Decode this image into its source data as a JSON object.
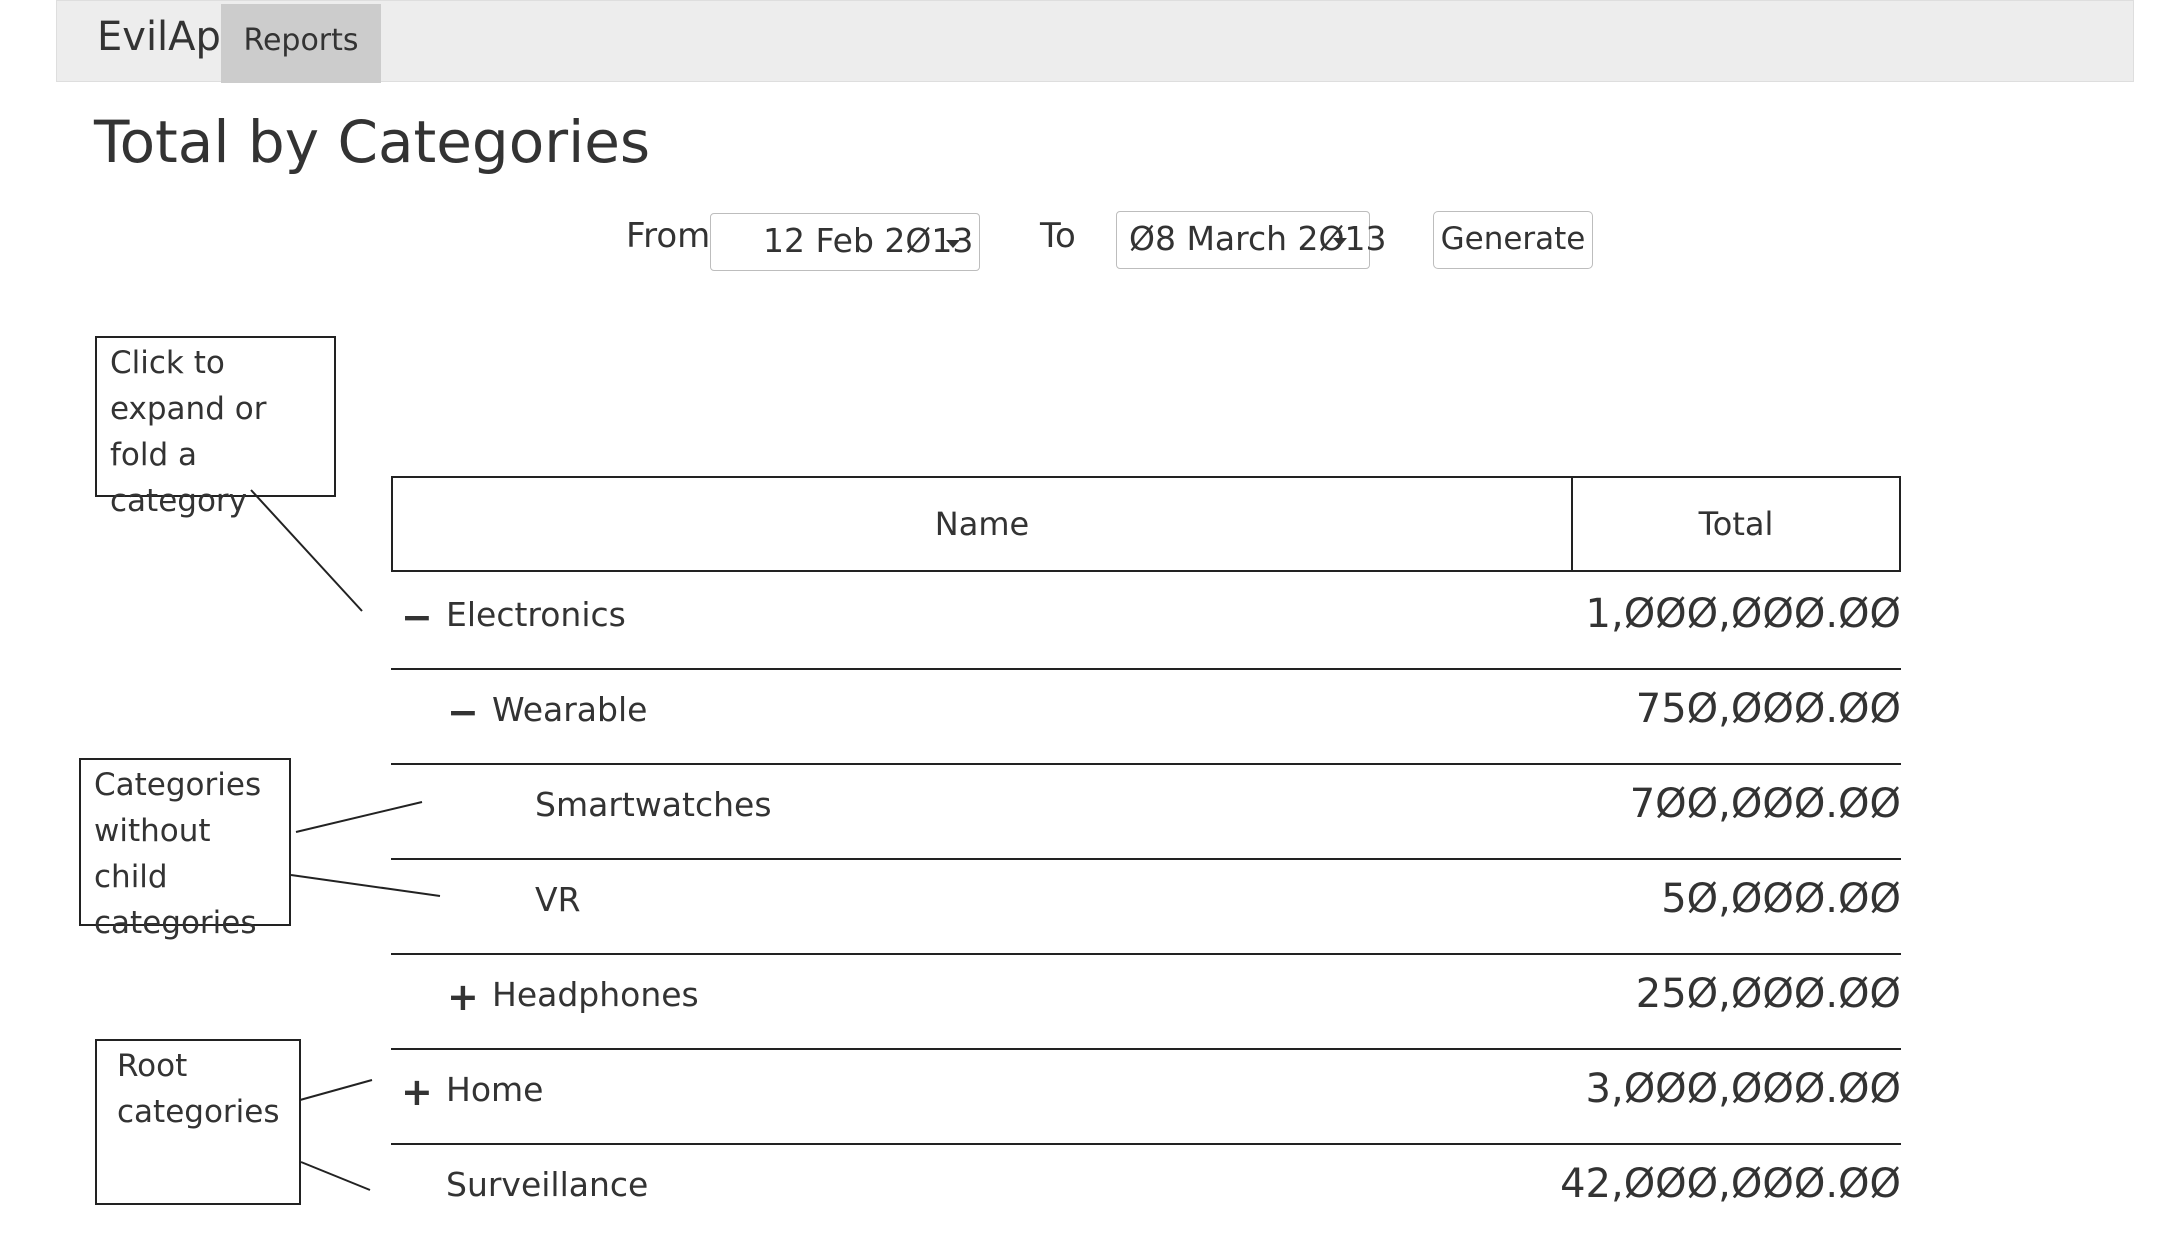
{
  "navbar": {
    "brand": "EvilApp",
    "tabs": [
      {
        "label": "Reports",
        "active": true
      }
    ]
  },
  "page": {
    "title": "Total  by Categories"
  },
  "filters": {
    "from_label": "From",
    "from_value": "12 Feb 2Ø13",
    "to_label": "To",
    "to_value": "Ø8 March 2Ø13",
    "generate_label": "Generate"
  },
  "table": {
    "columns": [
      "Name",
      "Total"
    ],
    "rows": [
      {
        "toggle": "−",
        "name": "Electronics",
        "total": "1,ØØØ,ØØØ.ØØ",
        "level": 0,
        "state": "expanded"
      },
      {
        "toggle": "−",
        "name": "Wearable",
        "total": "75Ø,ØØØ.ØØ",
        "level": 1,
        "state": "expanded"
      },
      {
        "toggle": "",
        "name": "Smartwatches",
        "total": "7ØØ,ØØØ.ØØ",
        "level": 2,
        "state": "leaf"
      },
      {
        "toggle": "",
        "name": "VR",
        "total": "5Ø,ØØØ.ØØ",
        "level": 2,
        "state": "leaf"
      },
      {
        "toggle": "+",
        "name": "Headphones",
        "total": "25Ø,ØØØ.ØØ",
        "level": 1,
        "state": "collapsed"
      },
      {
        "toggle": "+",
        "name": "Home",
        "total": "3,ØØØ,ØØØ.ØØ",
        "level": 0,
        "state": "collapsed"
      },
      {
        "toggle": "",
        "name": "Surveillance",
        "total": "42,ØØØ,ØØØ.ØØ",
        "level": 0,
        "state": "leaf"
      }
    ]
  },
  "annotations": {
    "expand": [
      "Click  to",
      "expand or fold a",
      "category"
    ],
    "leaf": [
      "Categories",
      "without child",
      "categories"
    ],
    "root": [
      "Root",
      "categories"
    ]
  },
  "colors": {
    "navbar_bg": "#ededed",
    "active_tab_bg": "#cccccc",
    "text": "#333333"
  }
}
